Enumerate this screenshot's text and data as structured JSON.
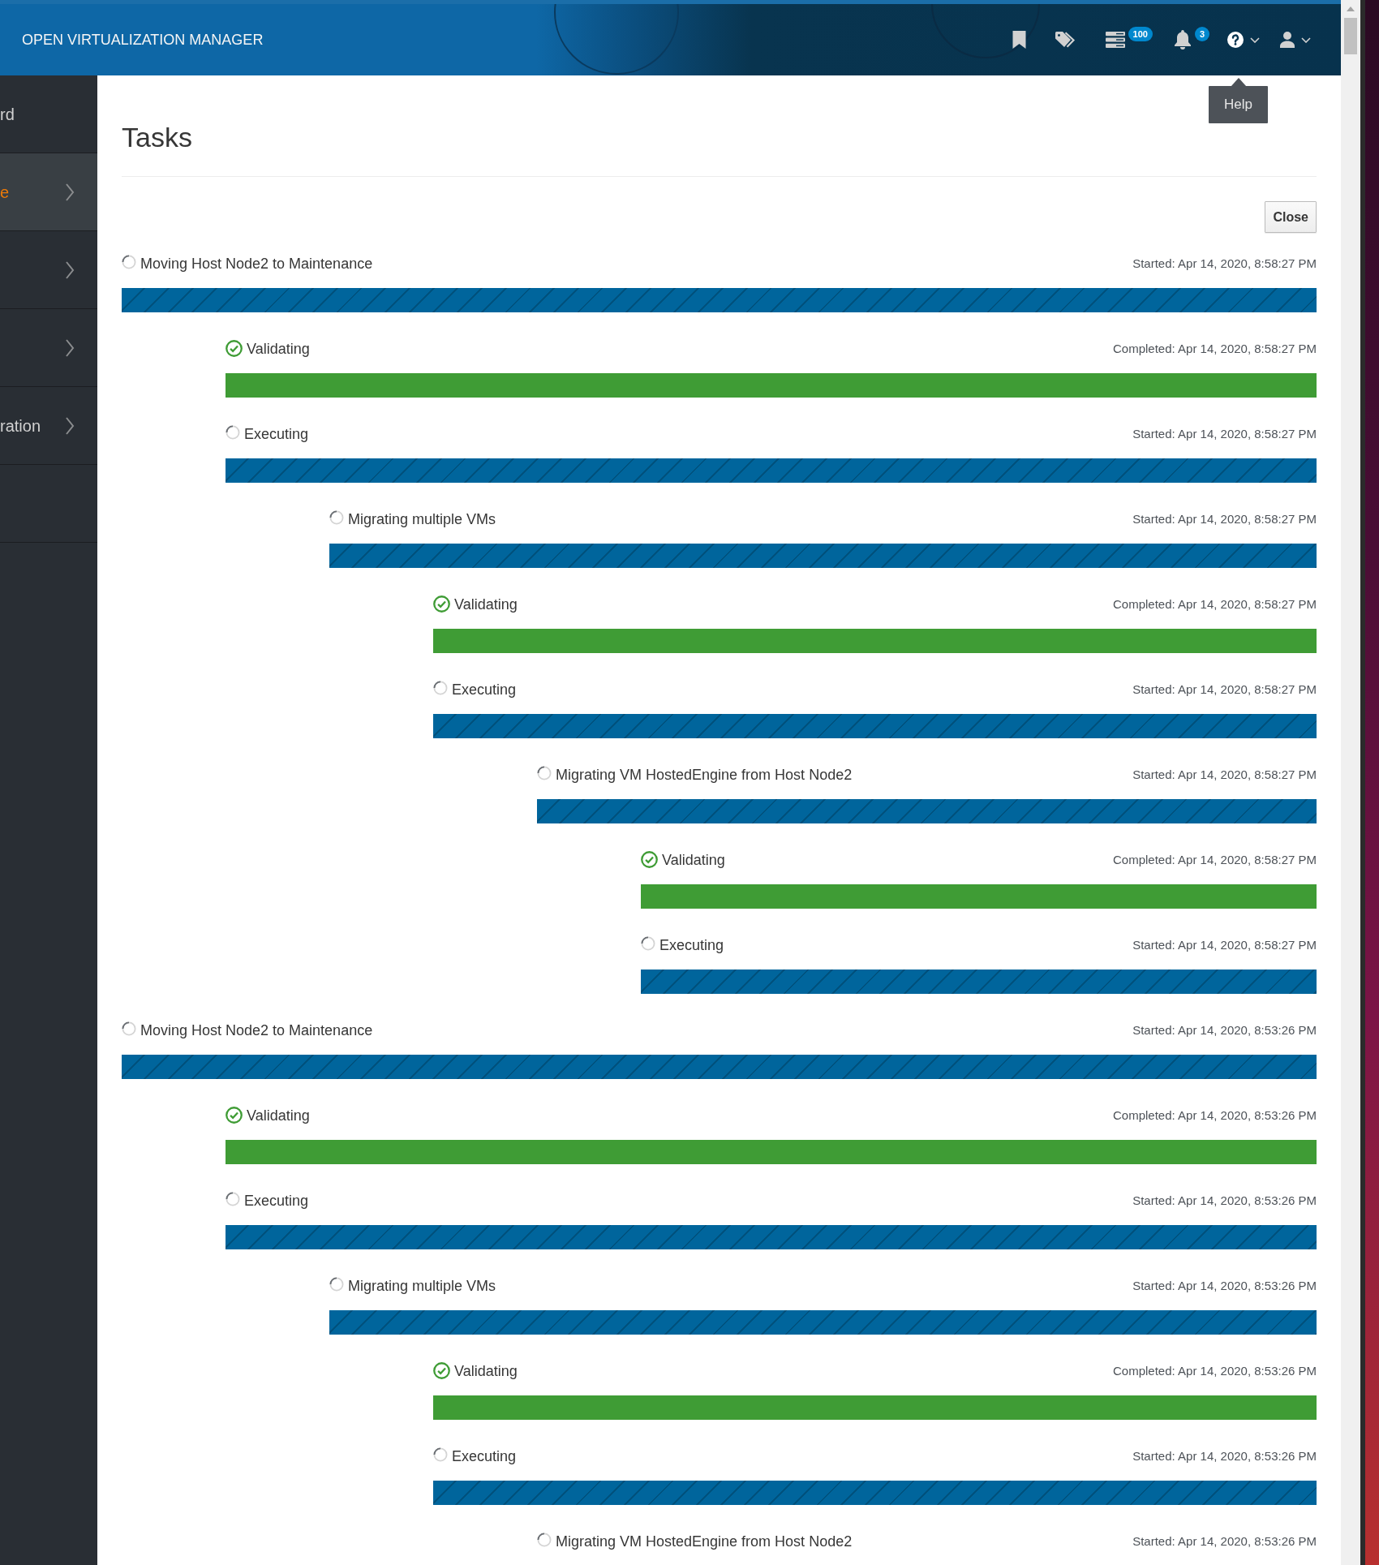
{
  "header": {
    "title": "OPEN VIRTUALIZATION MANAGER",
    "tools": [
      {
        "kind": "bookmark"
      },
      {
        "kind": "tags"
      },
      {
        "kind": "tasks",
        "badge": "100"
      },
      {
        "kind": "notifications",
        "badge": "3"
      },
      {
        "kind": "help",
        "dropdown": true
      },
      {
        "kind": "user",
        "dropdown": true
      }
    ]
  },
  "tooltip": {
    "text": "Help"
  },
  "sidebar": {
    "items": [
      {
        "label": "rd",
        "selected": false,
        "expandable": false
      },
      {
        "label": "e",
        "selected": true,
        "expandable": true
      },
      {
        "selected": false,
        "expandable": true
      },
      {
        "selected": false,
        "expandable": true
      },
      {
        "label": "ration",
        "selected": false,
        "expandable": true
      }
    ]
  },
  "page": {
    "title": "Tasks",
    "close_button": "Close",
    "tasks": [
      {
        "kind": "running",
        "name": "Moving Host Node2 to Maintenance",
        "time": "Started: Apr 14, 2020, 8:58:27 PM",
        "level": 1,
        "children": [
          {
            "kind": "completed",
            "name": "Validating",
            "time": "Completed: Apr 14, 2020, 8:58:27 PM",
            "level": 1
          },
          {
            "kind": "running",
            "name": "Executing",
            "time": "Started: Apr 14, 2020, 8:58:27 PM",
            "level": 1,
            "children": [
              {
                "kind": "running",
                "name": "Migrating multiple VMs",
                "time": "Started: Apr 14, 2020, 8:58:27 PM",
                "level": 1,
                "children": [
                  {
                    "kind": "completed",
                    "name": "Validating",
                    "time": "Completed: Apr 14, 2020, 8:58:27 PM",
                    "level": 1
                  },
                  {
                    "kind": "running",
                    "name": "Executing",
                    "time": "Started: Apr 14, 2020, 8:58:27 PM",
                    "level": 1,
                    "children": [
                      {
                        "kind": "running",
                        "name": "Migrating VM HostedEngine from Host Node2",
                        "time": "Started: Apr 14, 2020, 8:58:27 PM",
                        "level": 1,
                        "children": [
                          {
                            "kind": "completed",
                            "name": "Validating",
                            "time": "Completed: Apr 14, 2020, 8:58:27 PM",
                            "level": 1
                          },
                          {
                            "kind": "running",
                            "name": "Executing",
                            "time": "Started: Apr 14, 2020, 8:58:27 PM",
                            "level": 1
                          }
                        ]
                      }
                    ]
                  }
                ]
              }
            ]
          }
        ]
      },
      {
        "kind": "running",
        "name": "Moving Host Node2 to Maintenance",
        "time": "Started: Apr 14, 2020, 8:53:26 PM",
        "level": 1,
        "children": [
          {
            "kind": "completed",
            "name": "Validating",
            "time": "Completed: Apr 14, 2020, 8:53:26 PM",
            "level": 1
          },
          {
            "kind": "running",
            "name": "Executing",
            "time": "Started: Apr 14, 2020, 8:53:26 PM",
            "level": 1,
            "children": [
              {
                "kind": "running",
                "name": "Migrating multiple VMs",
                "time": "Started: Apr 14, 2020, 8:53:26 PM",
                "level": 1,
                "children": [
                  {
                    "kind": "completed",
                    "name": "Validating",
                    "time": "Completed: Apr 14, 2020, 8:53:26 PM",
                    "level": 1
                  },
                  {
                    "kind": "running",
                    "name": "Executing",
                    "time": "Started: Apr 14, 2020, 8:53:26 PM",
                    "level": 1,
                    "children": [
                      {
                        "kind": "running",
                        "name": "Migrating VM HostedEngine from Host Node2",
                        "time": "Started: Apr 14, 2020, 8:53:26 PM"
                      }
                    ]
                  }
                ]
              }
            ]
          }
        ]
      }
    ]
  }
}
